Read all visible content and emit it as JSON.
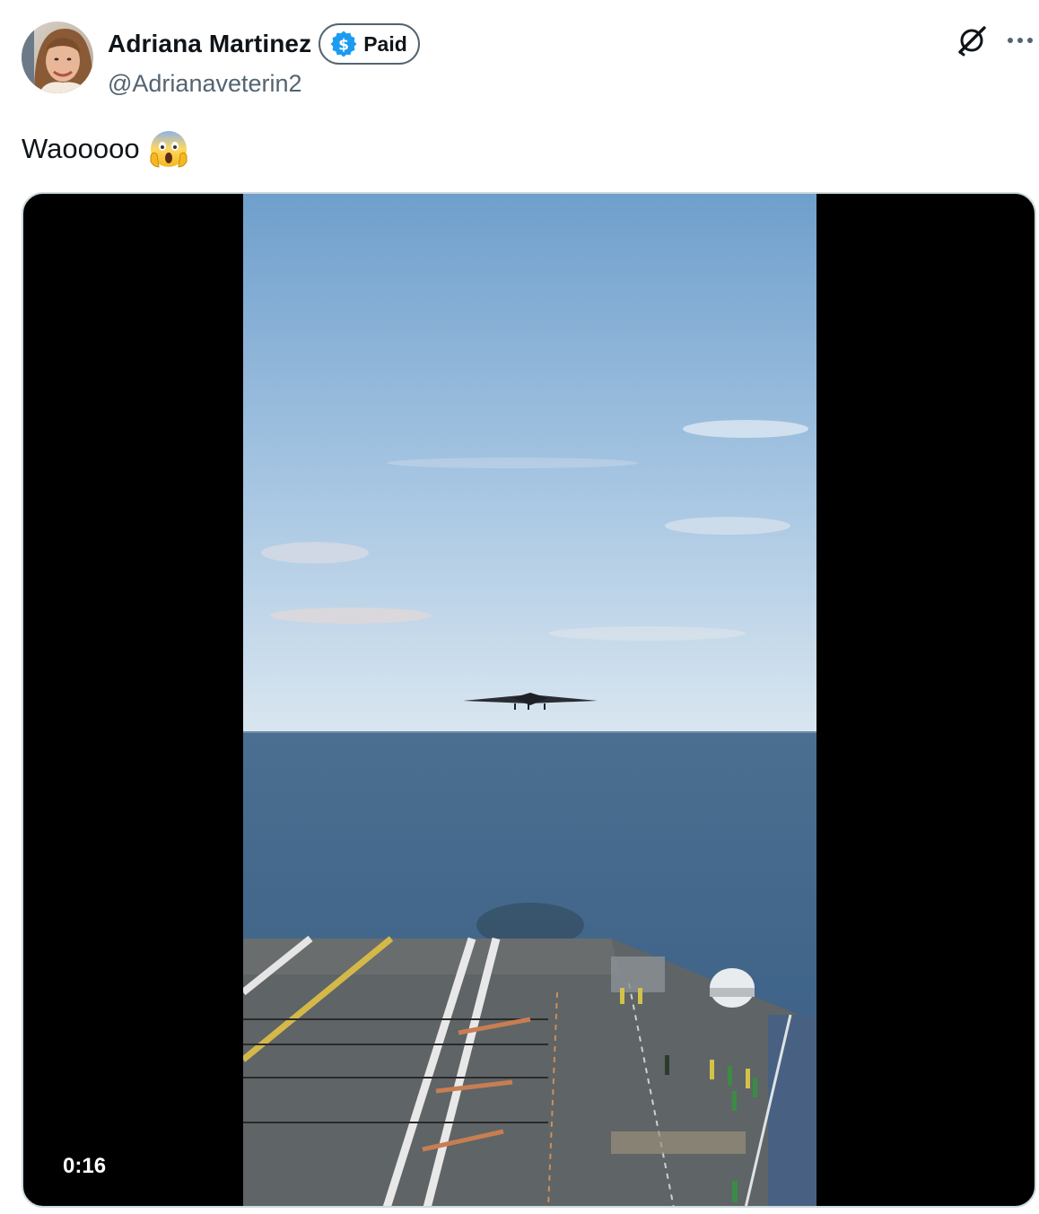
{
  "author": {
    "display_name": "Adriana Martinez",
    "handle": "@Adrianaveterin2",
    "badge": {
      "label": "Paid",
      "icon": "dollar-icon",
      "icon_color": "#1d9bf0"
    }
  },
  "actions": {
    "grok_icon": "grok-icon",
    "more_icon": "more-icon"
  },
  "tweet": {
    "text": "Waooooo",
    "emoji": "face-screaming-in-fear-emoji"
  },
  "media": {
    "type": "video",
    "duration": "0:16"
  },
  "colors": {
    "primary_text": "#0f1419",
    "secondary_text": "#536471",
    "border": "#cfd9de"
  }
}
